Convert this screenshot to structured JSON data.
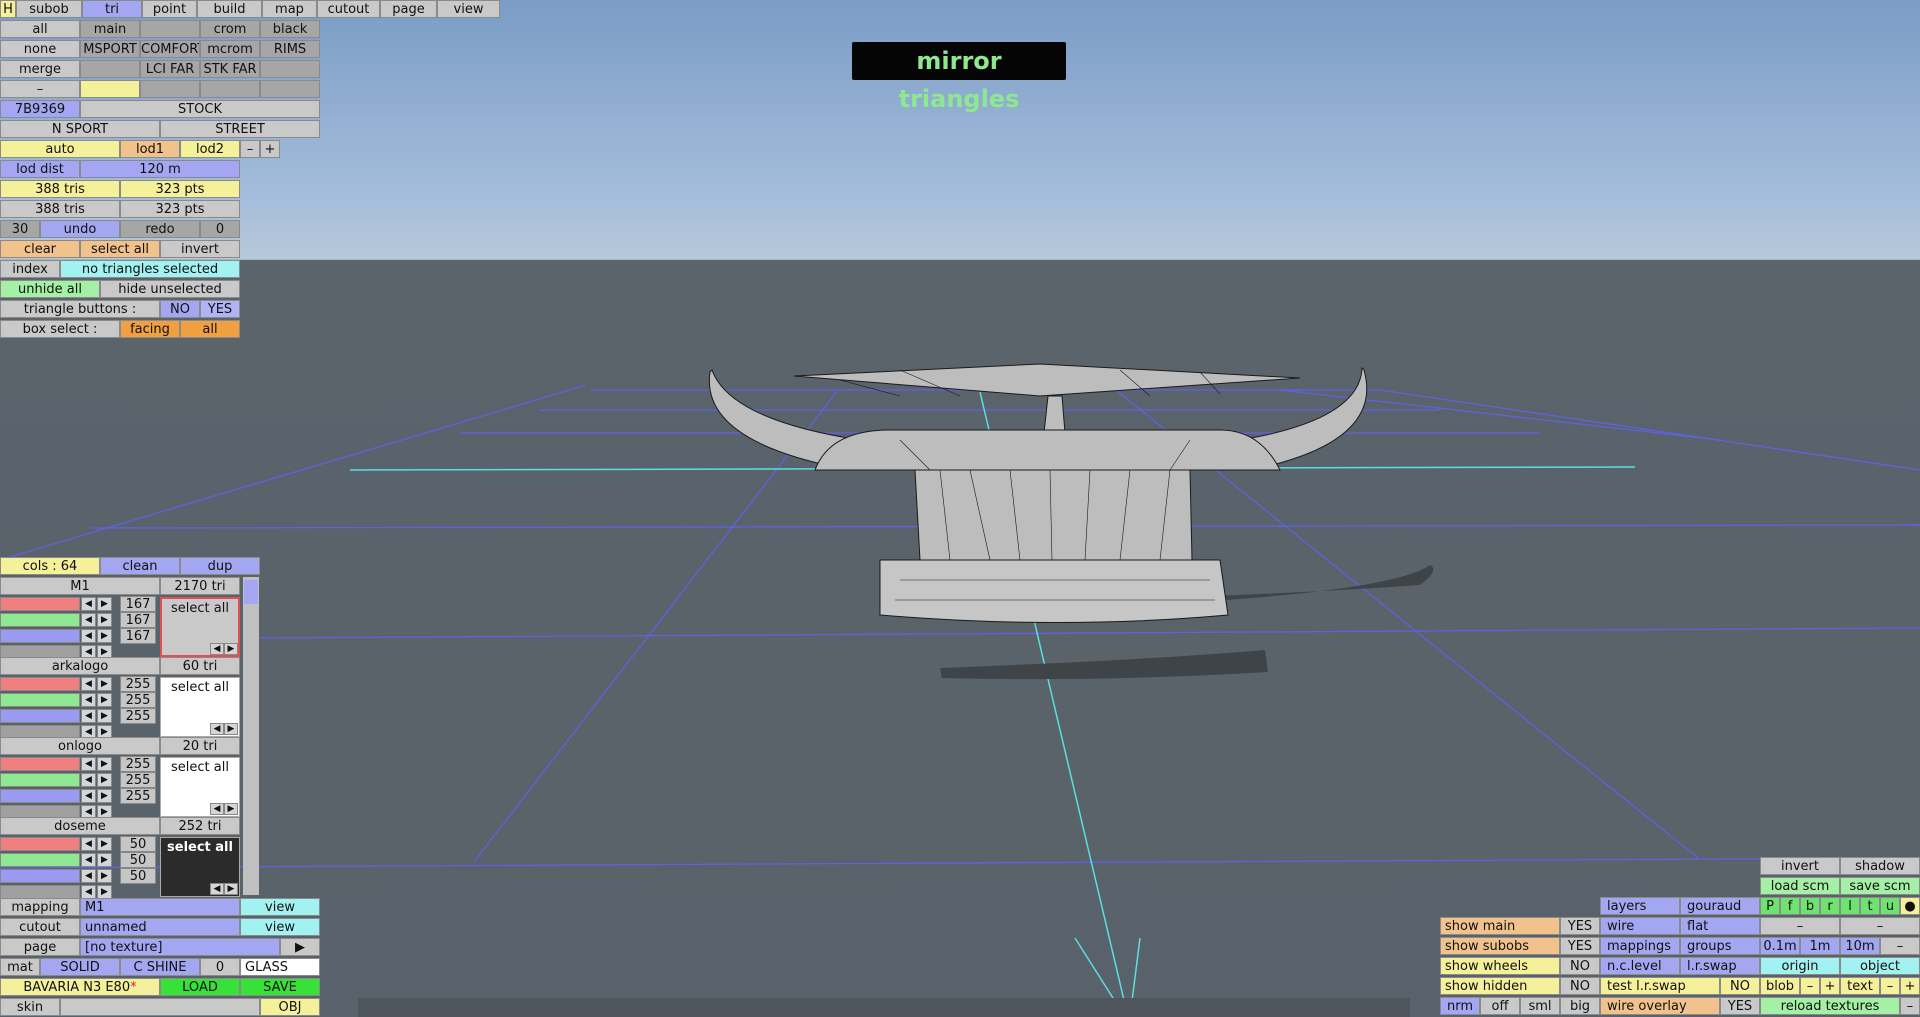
{
  "toolbar_top": {
    "h": "H",
    "subob": "subob",
    "tri": "tri",
    "point": "point",
    "build": "build",
    "map": "map",
    "cutout": "cutout",
    "page": "page",
    "view": "view"
  },
  "left_grid": {
    "row1": [
      "all",
      "main",
      "",
      "crom",
      "black"
    ],
    "row2": [
      "none",
      "MSPORT",
      "COMFORT",
      "mcrom",
      "RIMS"
    ],
    "row3": [
      "merge",
      "",
      "LCI FAR",
      "STK FAR",
      ""
    ],
    "row4": [
      "–",
      "",
      "",
      "",
      ""
    ],
    "code": "7B9369",
    "stock": "STOCK",
    "nsport": "N SPORT",
    "street": "STREET",
    "auto": "auto",
    "lod1": "lod1",
    "lod2": "lod2",
    "minus": "–",
    "plus": "+",
    "lod_dist_label": "lod dist",
    "lod_dist_value": "120 m",
    "tris1": "388 tris",
    "pts1": "323 pts",
    "tris2": "388 tris",
    "pts2": "323 pts",
    "undo_count": "30",
    "undo": "undo",
    "redo": "redo",
    "redo_count": "0",
    "clear": "clear",
    "select_all": "select all",
    "invert": "invert",
    "index": "index",
    "index_status": "no triangles selected",
    "unhide_all": "unhide all",
    "hide_unselected": "hide unselected",
    "tri_buttons": "triangle buttons :",
    "no": "NO",
    "yes": "YES",
    "box_select": "box select :",
    "facing": "facing",
    "all": "all"
  },
  "title_label": "mirror triangles",
  "materials_panel": {
    "cols": "cols : 64",
    "clean": "clean",
    "dup": "dup",
    "items": [
      {
        "name": "M1",
        "tri": "2170 tri",
        "v": [
          "167",
          "167",
          "167"
        ],
        "select": "select all"
      },
      {
        "name": "arkalogo",
        "tri": "60 tri",
        "v": [
          "255",
          "255",
          "255"
        ],
        "select": "select all"
      },
      {
        "name": "onlogo",
        "tri": "20 tri",
        "v": [
          "255",
          "255",
          "255"
        ],
        "select": "select all"
      },
      {
        "name": "doseme",
        "tri": "252 tri",
        "v": [
          "50",
          "50",
          "50"
        ],
        "select": "select all"
      }
    ]
  },
  "bottom_left": {
    "mapping": "mapping",
    "mapping_value": "M1",
    "view": "view",
    "cutout": "cutout",
    "cutout_value": "unnamed",
    "page": "page",
    "page_value": "[no texture]",
    "arrow": "▶",
    "mat": "mat",
    "solid": "SOLID",
    "cshine": "C SHINE",
    "zero": "0",
    "glass": "GLASS",
    "car_name": "BAVARIA N3 E80",
    "star": "*",
    "load": "LOAD",
    "save": "SAVE",
    "skin": "skin",
    "obj": "OBJ"
  },
  "bottom_right": {
    "invert": "invert",
    "shadow": "shadow",
    "load_scm": "load scm",
    "save_scm": "save scm",
    "pfbr": [
      "P",
      "f",
      "b",
      "r",
      "l",
      "t",
      "u",
      "●"
    ],
    "show_main": "show main",
    "show_main_v": "YES",
    "show_subobs": "show subobs",
    "show_subobs_v": "YES",
    "show_wheels": "show wheels",
    "show_wheels_v": "NO",
    "show_hidden": "show hidden",
    "show_hidden_v": "NO",
    "layers": "layers",
    "gouraud": "gouraud",
    "wire": "wire",
    "flat": "flat",
    "mappings": "mappings",
    "groups": "groups",
    "nclevel": "n.c.level",
    "lrswap": "l.r.swap",
    "test_lrswap": "test l.r.swap",
    "test_lrswap_v": "NO",
    "wire_overlay": "wire overlay",
    "wire_overlay_v": "YES",
    "dash": "–",
    "d01": "0.1m",
    "d1": "1m",
    "d10": "10m",
    "origin": "origin",
    "object": "object",
    "blob": "blob",
    "text": "text",
    "minus": "–",
    "plus": "+",
    "reload": "reload textures",
    "nrm": "nrm",
    "off": "off",
    "sml": "sml",
    "big": "big"
  },
  "colors": {
    "accent_blue": "#a3a7f2",
    "accent_yellow": "#f5f09a",
    "accent_orange": "#f2c28c",
    "cyan": "#a3f2f2",
    "green": "#a4f0a4"
  }
}
